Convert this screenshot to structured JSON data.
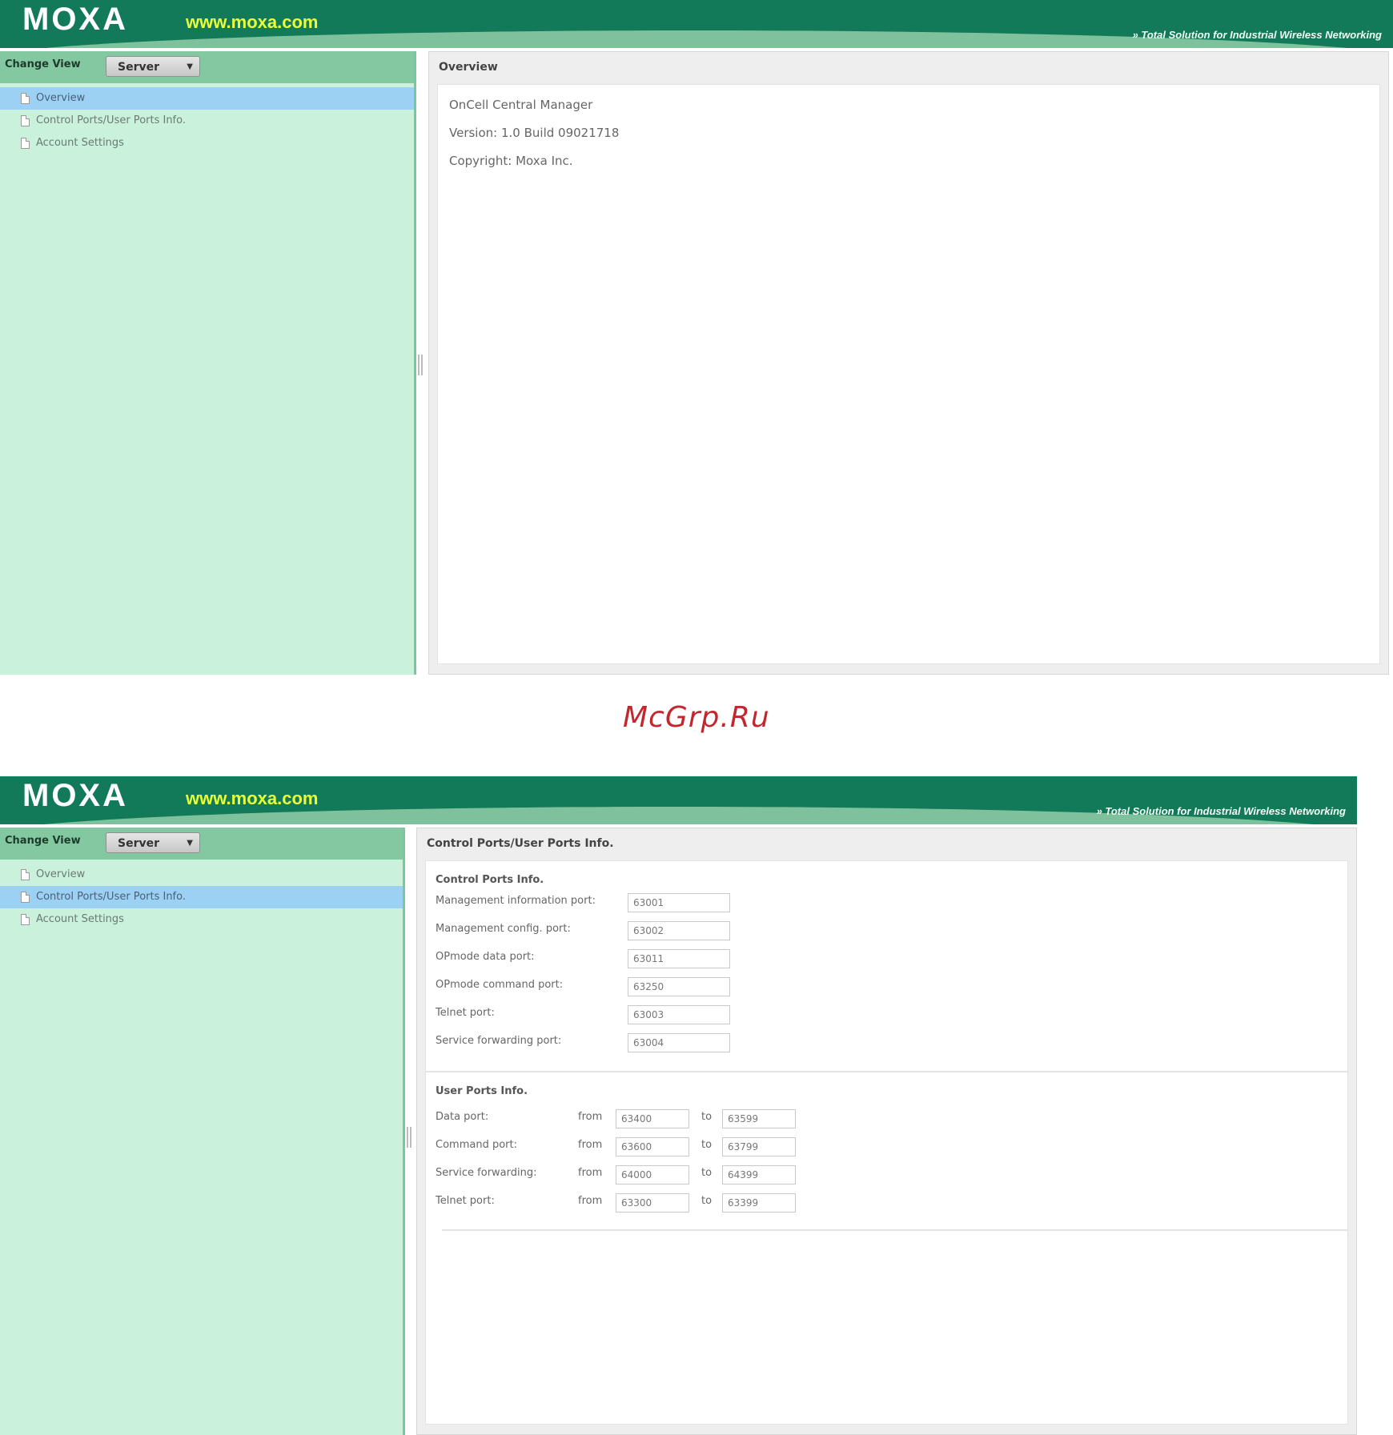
{
  "header": {
    "logo": "MOXA",
    "url": "www.moxa.com",
    "tagline": "» Total Solution for Industrial Wireless Networking"
  },
  "sidebar": {
    "change_view_label": "Change View",
    "view_select": "Server",
    "items": [
      "Overview",
      "Control Ports/User Ports Info.",
      "Account Settings"
    ]
  },
  "overview": {
    "title": "Overview",
    "product": "OnCell Central Manager",
    "version": "Version: 1.0 Build 09021718",
    "copyright": "Copyright: Moxa Inc."
  },
  "ports": {
    "title": "Control Ports/User Ports Info.",
    "control_title": "Control Ports Info.",
    "control": [
      {
        "label": "Management information port:",
        "value": "63001"
      },
      {
        "label": "Management config. port:",
        "value": "63002"
      },
      {
        "label": "OPmode data port:",
        "value": "63011"
      },
      {
        "label": "OPmode command port:",
        "value": "63250"
      },
      {
        "label": "Telnet port:",
        "value": "63003"
      },
      {
        "label": "Service forwarding port:",
        "value": "63004"
      }
    ],
    "user_title": "User Ports Info.",
    "from_label": "from",
    "to_label": "to",
    "user": [
      {
        "label": "Data port:",
        "from": "63400",
        "to": "63599"
      },
      {
        "label": "Command port:",
        "from": "63600",
        "to": "63799"
      },
      {
        "label": "Service forwarding:",
        "from": "64000",
        "to": "64399"
      },
      {
        "label": "Telnet port:",
        "from": "63300",
        "to": "63399"
      }
    ]
  },
  "watermark": "McGrp.Ru"
}
